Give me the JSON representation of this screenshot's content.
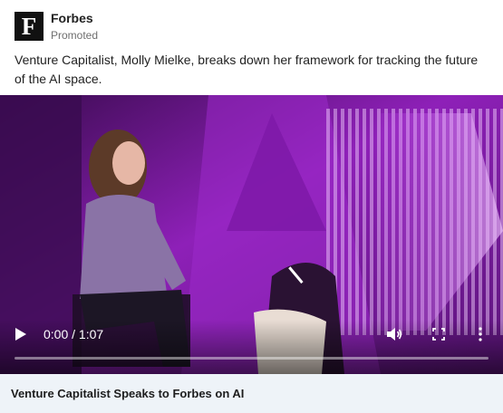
{
  "post": {
    "company": "Forbes",
    "logo_letter": "F",
    "sponsored_label": "Promoted",
    "text": "Venture Capitalist, Molly Mielke, breaks down her framework for tracking the future of the AI space."
  },
  "video": {
    "current_time": "0:00",
    "duration": "1:07",
    "time_display": "0:00 / 1:07",
    "progress": 0,
    "icons": {
      "play": "play-icon",
      "volume": "volume-icon",
      "fullscreen": "fullscreen-icon",
      "more": "more-options-icon"
    },
    "scene_colors": {
      "bg": "#3c0f55",
      "accent": "#b12ee0",
      "light": "#e9b8ff"
    }
  },
  "caption": {
    "title": "Venture Capitalist Speaks to Forbes on AI"
  }
}
